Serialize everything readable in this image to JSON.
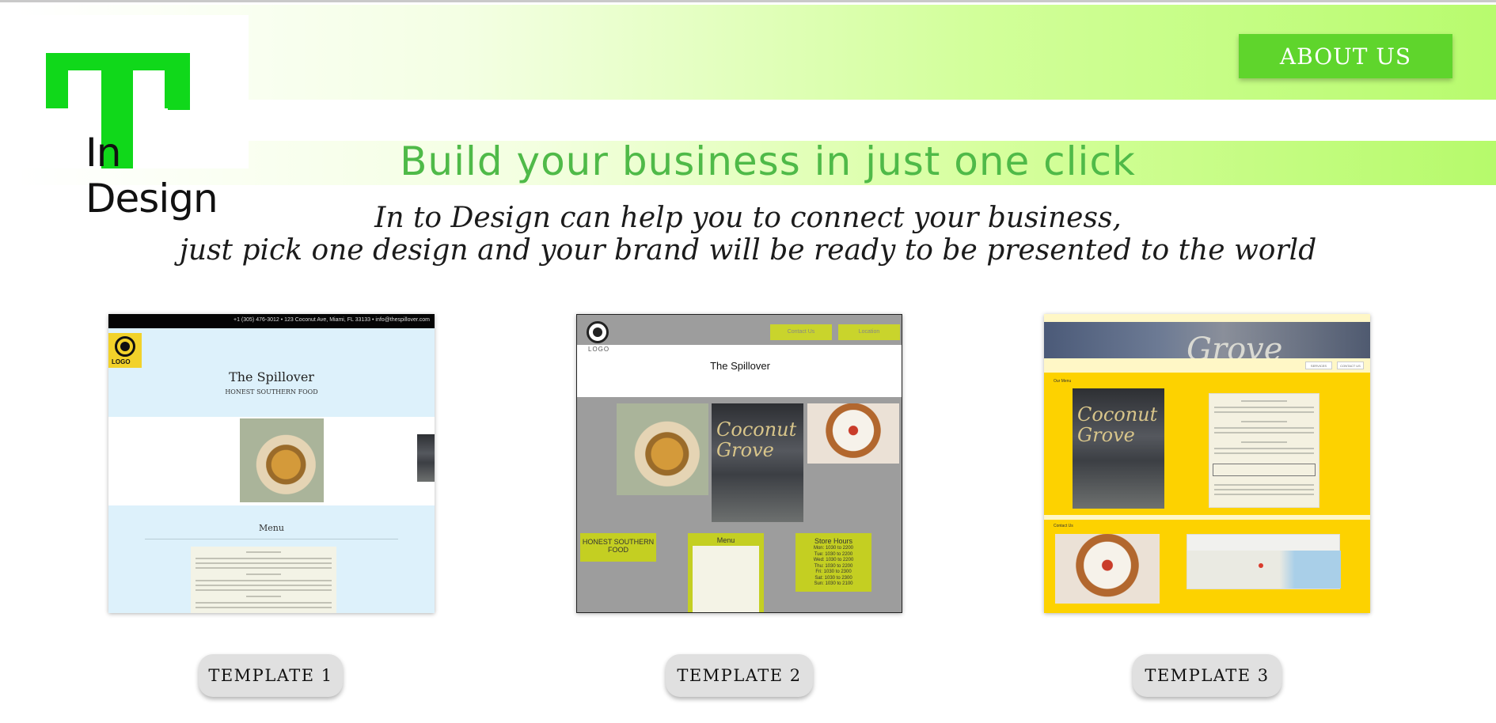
{
  "header": {
    "logo_text": "In Design",
    "about_label": "ABOUT US",
    "headline": "Build your business in just one click",
    "tagline_line1": "In to Design can help you to connect your business,",
    "tagline_line2": "just pick one design and your brand will be ready to be presented to the world"
  },
  "templates": [
    {
      "button_label": "TEMPLATE 1",
      "preview": {
        "topbar": "+1 (305) 476-3012   •   123 Coconut Ave, Miami, FL 33133   •   info@thespillover.com",
        "logo_text": "LOGO",
        "title": "The Spillover",
        "subtitle": "HONEST SOUTHERN FOOD",
        "menu_title": "Menu"
      }
    },
    {
      "button_label": "TEMPLATE 2",
      "preview": {
        "nav": [
          "Contact Us",
          "Location"
        ],
        "logo_text": "LOGO",
        "title": "The Spillover",
        "box_left": "HONEST SOUTHERN FOOD",
        "box_menu": "Menu",
        "box_hours_title": "Store Hours",
        "hours": [
          "Mon: 1030 to 2200",
          "Tue: 1030 to 2200",
          "Wed: 1030 to 2200",
          "Thu: 1030 to 2200",
          "Fri: 1030 to 2300",
          "Sat: 1030 to 2300",
          "Sun: 1030 to 2100"
        ]
      }
    },
    {
      "button_label": "TEMPLATE 3",
      "preview": {
        "banner_text": "Grove",
        "nav": [
          "SERVICES",
          "CONTACT US"
        ],
        "section1": "Our Menu",
        "section2": "Contact Us",
        "wall_text": "Coconut Grove"
      }
    }
  ],
  "colors": {
    "accent_green": "#5fd52c",
    "headline_green": "#4fba48",
    "logo_green": "#10d81a"
  }
}
